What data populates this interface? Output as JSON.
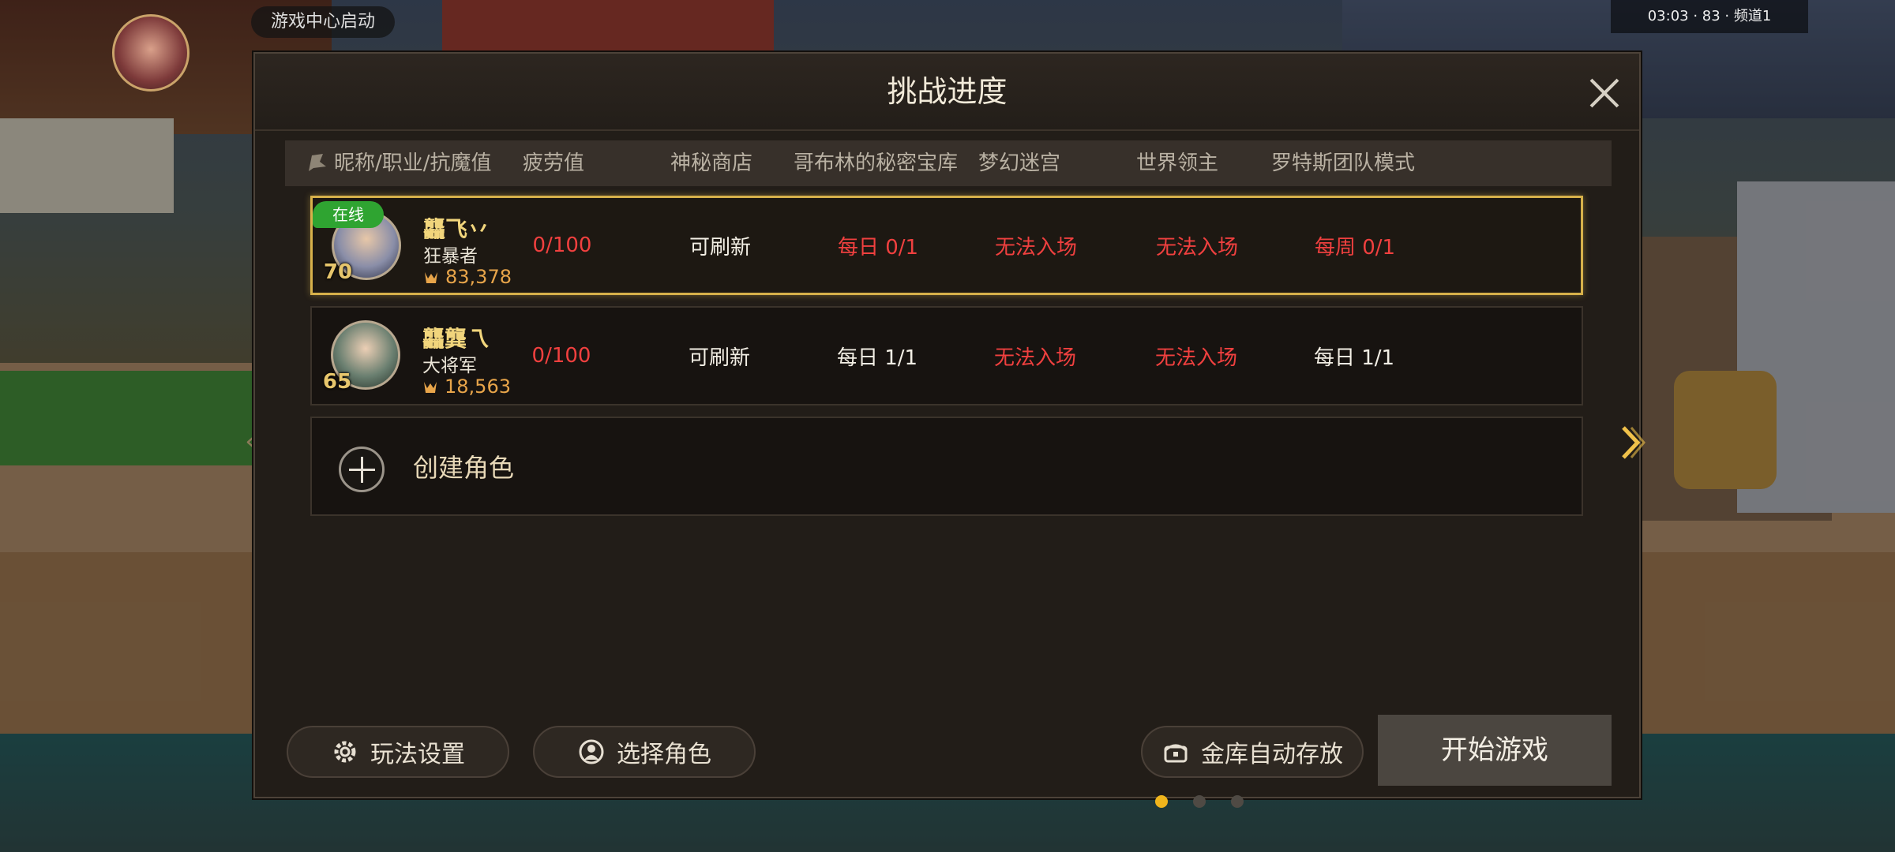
{
  "background": {
    "game_center_pill": "游戏中心启动",
    "status_bar": "03:03 · 83 · 频道1"
  },
  "dialog": {
    "title": "挑战进度",
    "columns": [
      "昵称/职业/抗魔值",
      "疲劳值",
      "神秘商店",
      "哥布林的秘密宝库",
      "梦幻迷宫",
      "世界领主",
      "罗特斯团队模式"
    ],
    "characters": [
      {
        "online_badge": "在线",
        "level": "70",
        "name": "龘飞丷",
        "job": "狂暴者",
        "anti_magic": "83,378",
        "fatigue": "0/100",
        "shop": "可刷新",
        "goblin": "每日 0/1",
        "maze": "无法入场",
        "world_boss": "无法入场",
        "rotus": "每周 0/1",
        "selected": true
      },
      {
        "online_badge": "",
        "level": "65",
        "name": "龘龔乁",
        "job": "大将军",
        "anti_magic": "18,563",
        "fatigue": "0/100",
        "shop": "可刷新",
        "goblin": "每日 1/1",
        "maze": "无法入场",
        "world_boss": "无法入场",
        "rotus": "每日 1/1",
        "selected": false
      }
    ],
    "create_label": "创建角色",
    "buttons": {
      "settings": "玩法设置",
      "select_char": "选择角色",
      "auto_store": "金库自动存放",
      "start": "开始游戏"
    },
    "pagination": {
      "pages": 3,
      "current": 1
    },
    "colors": {
      "accent_gold": "#d7b14a",
      "red": "#f0403f",
      "online_green": "#2fa431"
    }
  }
}
